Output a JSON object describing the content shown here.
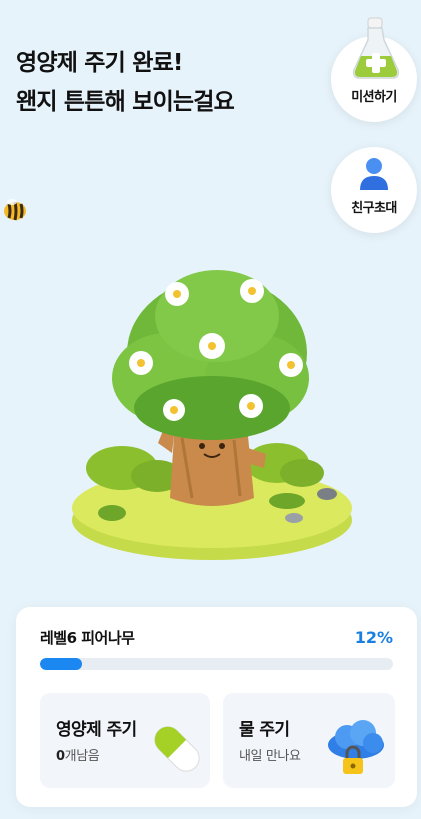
{
  "headline": {
    "line1": "영양제 주기 완료!",
    "line2": "왠지 튼튼해 보이는걸요"
  },
  "side_buttons": {
    "mission": {
      "label": "미션하기",
      "icon": "potion-flask-icon"
    },
    "invite": {
      "label": "친구초대",
      "icon": "person-icon"
    }
  },
  "tree": {
    "level_label": "레벨6 피어나무",
    "progress_text": "12%",
    "progress_fraction": 0.12
  },
  "actions": {
    "nutrient": {
      "title": "영양제 주기",
      "count": "0",
      "count_suffix": "개남음",
      "icon": "capsule-pill-icon"
    },
    "water": {
      "title": "물 주기",
      "subtitle": "내일 만나요",
      "icon": "locked-cloud-icon"
    }
  },
  "colors": {
    "background": "#e7f3fa",
    "accent": "#1b87f0",
    "card": "#ffffff"
  }
}
